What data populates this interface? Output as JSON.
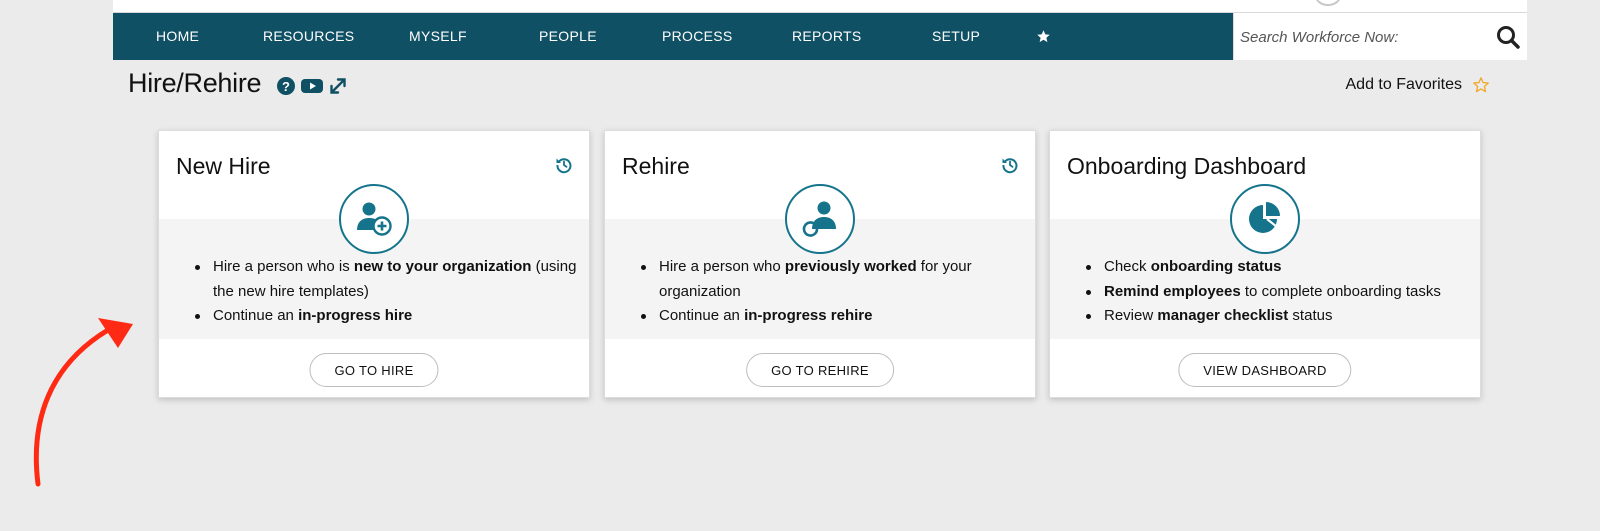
{
  "nav": {
    "items": [
      "HOME",
      "RESOURCES",
      "MYSELF",
      "PEOPLE",
      "PROCESS",
      "REPORTS",
      "SETUP"
    ],
    "search_placeholder": "Search Workforce Now:"
  },
  "page": {
    "title": "Hire/Rehire",
    "add_to_favorites": "Add to Favorites"
  },
  "cards": [
    {
      "title": "New Hire",
      "icon": "user-add-icon",
      "bullets": [
        {
          "pre": "Hire a person who is ",
          "bold": "new to your organization",
          "post": " (using the new hire templates)"
        },
        {
          "pre": "Continue an ",
          "bold": "in-progress hire",
          "post": ""
        }
      ],
      "button": "GO TO HIRE"
    },
    {
      "title": "Rehire",
      "icon": "user-rehire-icon",
      "bullets": [
        {
          "pre": "Hire a person who ",
          "bold": "previously worked",
          "post": " for your organization"
        },
        {
          "pre": "Continue an ",
          "bold": "in-progress rehire",
          "post": ""
        }
      ],
      "button": "GO TO REHIRE"
    },
    {
      "title": "Onboarding Dashboard",
      "icon": "pie-chart-icon",
      "bullets": [
        {
          "pre": "Check ",
          "bold": "onboarding status",
          "post": ""
        },
        {
          "pre": "",
          "bold": "Remind employees",
          "post": " to complete onboarding tasks"
        },
        {
          "pre": "Review ",
          "bold": "manager checklist",
          "post": " status"
        }
      ],
      "button": "VIEW DASHBOARD"
    }
  ],
  "colors": {
    "nav_bg": "#0f5064",
    "accent": "#15748c",
    "favorite_star": "#f0a92c",
    "annotation_arrow": "#ff2a14"
  }
}
